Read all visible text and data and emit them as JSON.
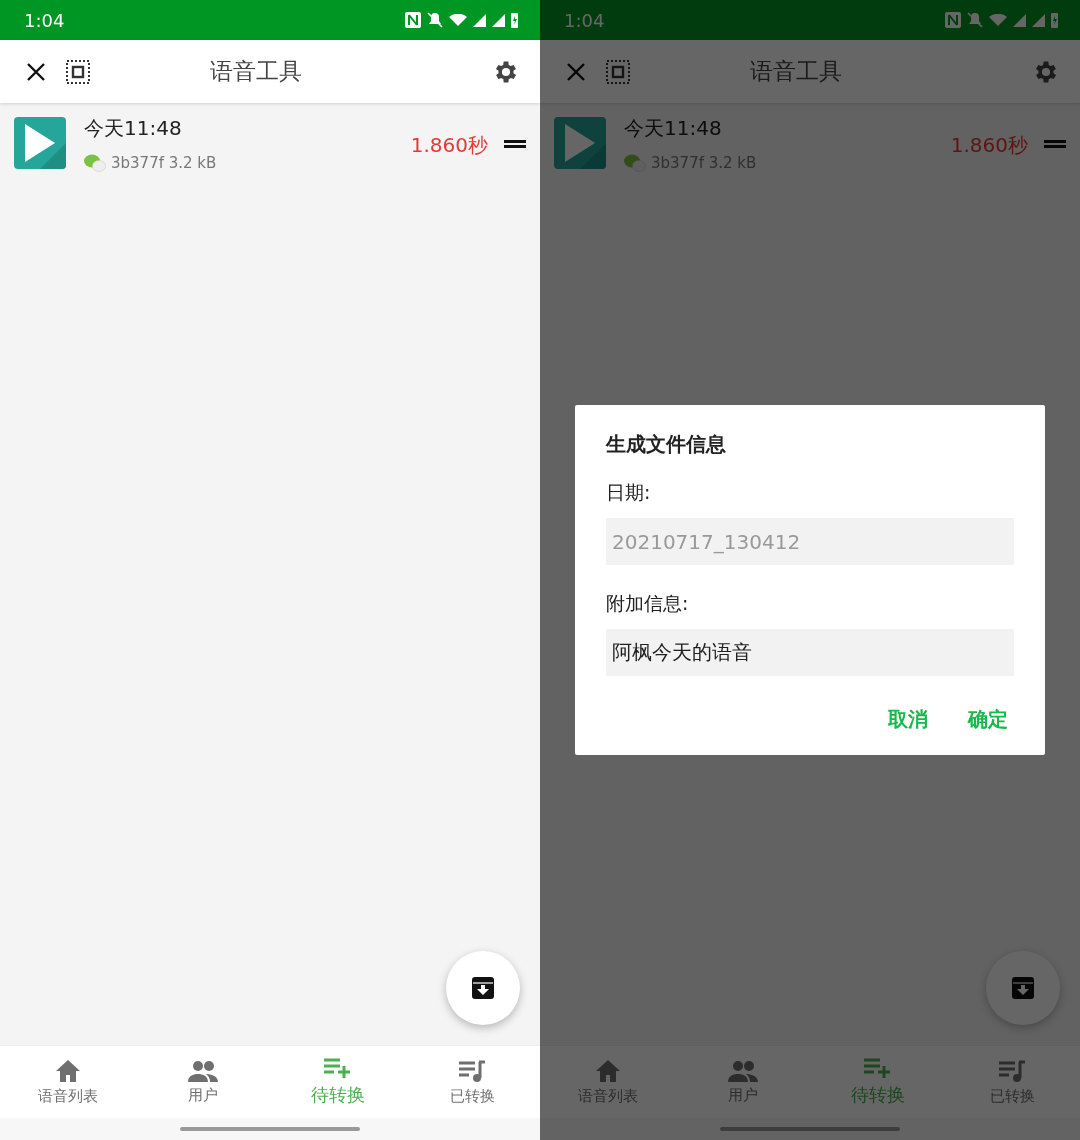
{
  "screens": [
    {
      "dimmed": false,
      "status_bar": {
        "time": "1:04"
      },
      "app_bar": {
        "title": "语音工具"
      },
      "items": [
        {
          "time": "今天11:48",
          "meta": "3b377f 3.2 kB",
          "duration": "1.860秒"
        }
      ],
      "tabs": [
        {
          "kind": "home",
          "label": "语音列表",
          "selected": false
        },
        {
          "kind": "people",
          "label": "用户",
          "selected": false
        },
        {
          "kind": "add",
          "label": "待转换",
          "selected": true
        },
        {
          "kind": "music",
          "label": "已转换",
          "selected": false
        }
      ]
    },
    {
      "dimmed": true,
      "status_bar": {
        "time": "1:04"
      },
      "app_bar": {
        "title": "语音工具"
      },
      "items": [
        {
          "time": "今天11:48",
          "meta": "3b377f 3.2 kB",
          "duration": "1.860秒"
        }
      ],
      "tabs": [
        {
          "kind": "home",
          "label": "语音列表",
          "selected": false
        },
        {
          "kind": "people",
          "label": "用户",
          "selected": false
        },
        {
          "kind": "add",
          "label": "待转换",
          "selected": true
        },
        {
          "kind": "music",
          "label": "已转换",
          "selected": false
        }
      ],
      "dialog": {
        "title": "生成文件信息",
        "fields": [
          {
            "label": "日期:",
            "value": "20210717_130412",
            "disabled": true
          },
          {
            "label": "附加信息:",
            "value": "阿枫今天的语音",
            "disabled": false
          }
        ],
        "buttons": [
          "取消",
          "确定"
        ]
      }
    }
  ]
}
